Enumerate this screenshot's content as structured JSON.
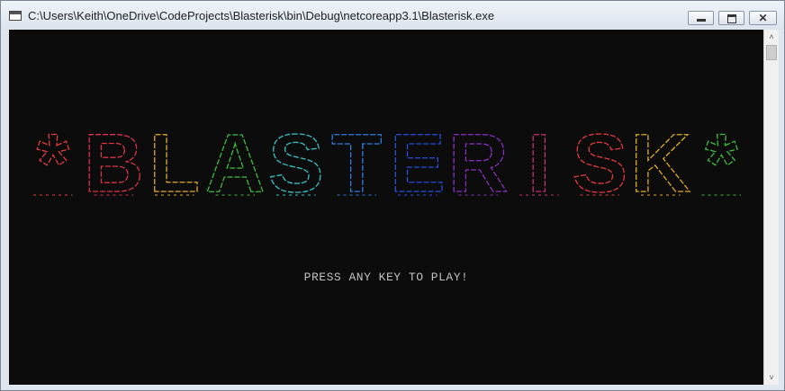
{
  "window": {
    "title": "C:\\Users\\Keith\\OneDrive\\CodeProjects\\Blasterisk\\bin\\Debug\\netcoreapp3.1\\Blasterisk.exe",
    "icon": "console-app-icon",
    "controls": {
      "minimize_icon": "minimize-icon",
      "maximize_icon": "maximize-icon",
      "close_glyph": "✕"
    }
  },
  "console": {
    "banner": {
      "text": "*BLASTERISK*",
      "letters": [
        {
          "char": "*",
          "color": "#e23b3b"
        },
        {
          "char": "B",
          "color": "#d8344a"
        },
        {
          "char": "L",
          "color": "#e0a92a"
        },
        {
          "char": "A",
          "color": "#3dbb3d"
        },
        {
          "char": "S",
          "color": "#37c0c8"
        },
        {
          "char": "T",
          "color": "#2f7de0"
        },
        {
          "char": "E",
          "color": "#2a4fd8"
        },
        {
          "char": "R",
          "color": "#8a2fc0"
        },
        {
          "char": "I",
          "color": "#c23070"
        },
        {
          "char": "S",
          "color": "#e23b3b"
        },
        {
          "char": "K",
          "color": "#e0a92a"
        },
        {
          "char": "*",
          "color": "#3dbb3d"
        }
      ]
    },
    "prompt": "PRESS ANY KEY TO PLAY!",
    "background": "#0c0c0c",
    "prompt_color": "#c0c0c0"
  },
  "scrollbar": {
    "up_glyph": "˄",
    "down_glyph": "˅"
  }
}
